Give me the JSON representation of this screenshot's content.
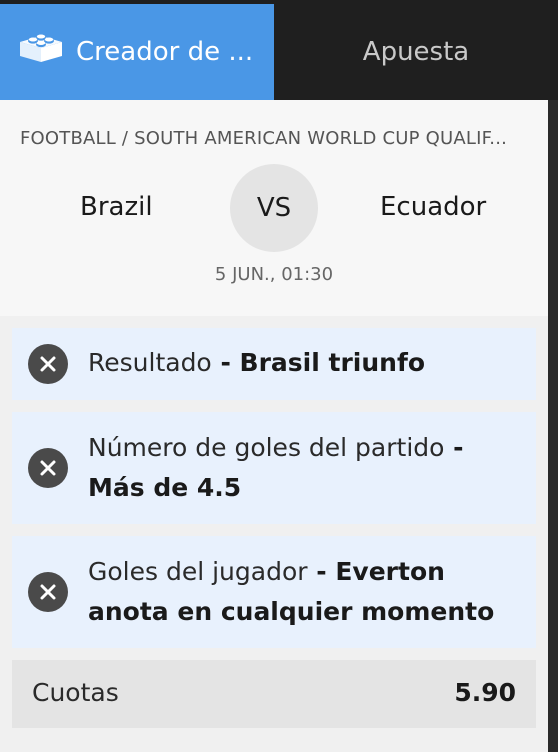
{
  "tabs": [
    {
      "label": "Creador de ...",
      "icon": "lego-brick-icon",
      "active": true
    },
    {
      "label": "Apuesta",
      "active": false
    }
  ],
  "event": {
    "league": "FOOTBALL / SOUTH AMERICAN WORLD CUP QUALIF...",
    "home_team": "Brazil",
    "vs": "VS",
    "away_team": "Ecuador",
    "datetime": "5 JUN., 01:30"
  },
  "selections": [
    {
      "market": "Resultado",
      "separator": " - ",
      "pick": "Brasil triunfo"
    },
    {
      "market": "Número de goles del partido",
      "separator": " - ",
      "pick": "Más de 4.5"
    },
    {
      "market": "Goles del jugador",
      "separator": " - ",
      "pick": "Everton anota en cualquier momento"
    }
  ],
  "odds": {
    "label": "Cuotas",
    "value": "5.90"
  },
  "colors": {
    "accent": "#4a97e6",
    "dark": "#1f1f1f",
    "selection_bg": "#e8f1fd",
    "remove_icon_bg": "#4a4a4a"
  }
}
